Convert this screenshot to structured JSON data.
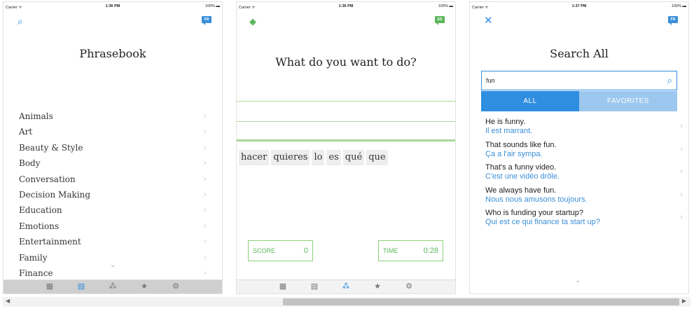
{
  "screens": [
    {
      "status": {
        "carrier": "Carrier ᯤ",
        "time": "1:36 PM",
        "battery": "100% ▬"
      },
      "lang_badge": "FR",
      "title": "Phrasebook",
      "categories": [
        "Animals",
        "Art",
        "Beauty & Style",
        "Body",
        "Conversation",
        "Decision Making",
        "Education",
        "Emotions",
        "Entertainment",
        "Family",
        "Finance"
      ]
    },
    {
      "status": {
        "carrier": "Carrier ᯤ",
        "time": "1:36 PM",
        "battery": "100% ▬"
      },
      "lang_badge": "ES",
      "prompt": "What do you want to do?",
      "tiles": [
        "hacer",
        "quieres",
        "lo",
        "es",
        "qué",
        "que"
      ],
      "score_label": "SCORE",
      "score_value": "0",
      "time_label": "TIME",
      "time_value": "0:28"
    },
    {
      "status": {
        "carrier": "Carrier ᯤ",
        "time": "1:37 PM",
        "battery": "100% ▬"
      },
      "lang_badge": "FR",
      "title": "Search All",
      "search_value": "fun",
      "segments": [
        "ALL",
        "FAVORITES"
      ],
      "results": [
        {
          "en": "He is funny.",
          "fr": "Il est marrant."
        },
        {
          "en": "That sounds like fun.",
          "fr": "Ça a l'air sympa."
        },
        {
          "en": "That's a funny video.",
          "fr": "C'est une vidéo drôle."
        },
        {
          "en": "We always have fun.",
          "fr": "Nous nous amusons toujours."
        },
        {
          "en": "Who is funding your startup?",
          "fr": "Qui est ce qui finance ta start up?"
        }
      ]
    }
  ],
  "icons": {
    "search": "⌕",
    "chevron": "›",
    "down": "⌄",
    "close": "✕",
    "gem": "◆",
    "tab_flashcards": "▦",
    "tab_phrasebook": "▤",
    "tab_game": "⁂",
    "tab_favorites": "★",
    "tab_settings": "⚙",
    "scroll_left": "◀",
    "scroll_right": "▶"
  },
  "colors": {
    "accent": "#2f8ee0",
    "green": "#5cb85c",
    "light_blue": "#9cc7ef"
  }
}
